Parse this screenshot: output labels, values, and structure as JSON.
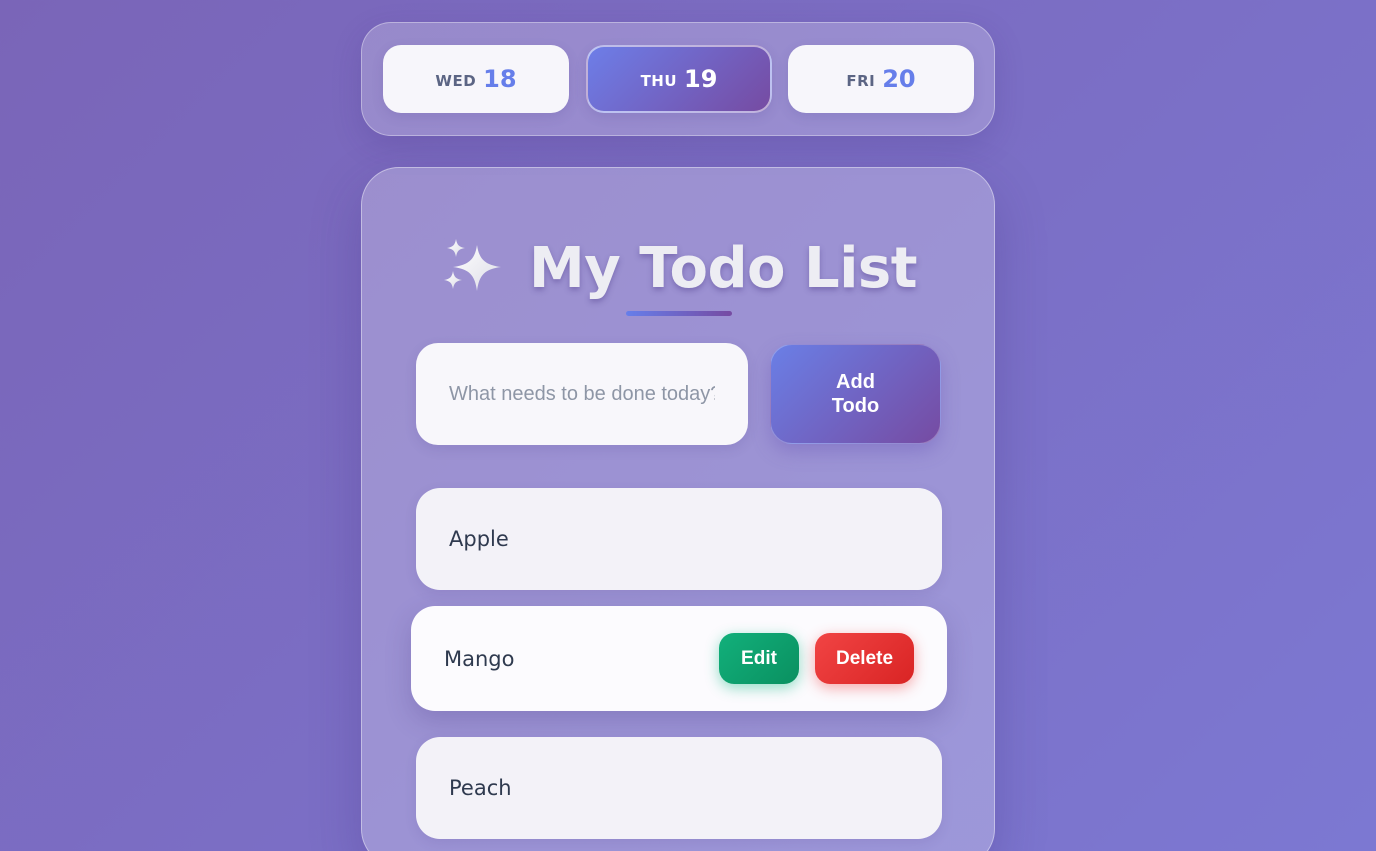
{
  "date_strip": {
    "days": [
      {
        "name": "WED",
        "num": "18",
        "active": false
      },
      {
        "name": "THU",
        "num": "19",
        "active": true
      },
      {
        "name": "FRI",
        "num": "20",
        "active": false
      }
    ]
  },
  "header": {
    "title": "My Todo List",
    "icon": "sparkles-icon"
  },
  "form": {
    "input_value": "",
    "placeholder": "What needs to be done today?",
    "add_label": "Add Todo"
  },
  "todos": [
    {
      "label": "Apple"
    },
    {
      "label": "Mango",
      "edit_label": "Edit",
      "delete_label": "Delete"
    },
    {
      "label": "Peach"
    }
  ],
  "colors": {
    "accent_start": "#667eea",
    "accent_end": "#764ba2",
    "edit": "#10b981",
    "delete": "#ef4444"
  }
}
